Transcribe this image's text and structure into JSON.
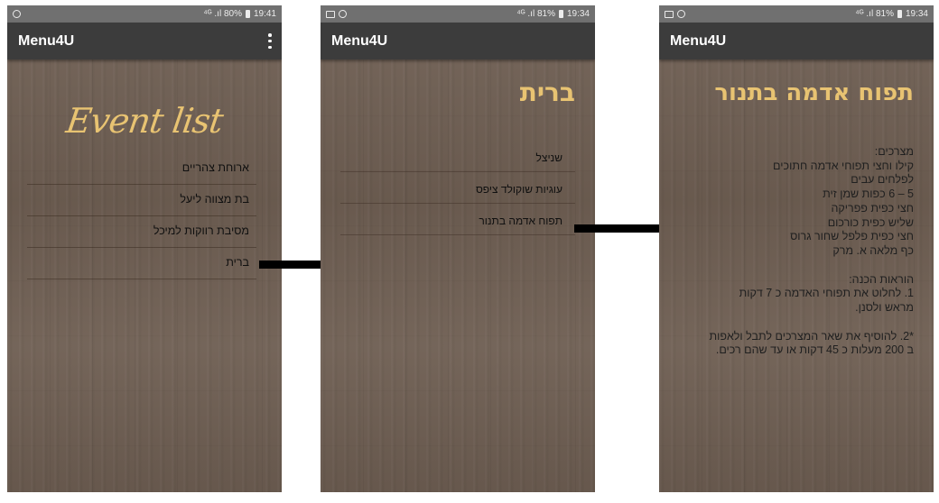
{
  "screens": [
    {
      "status": {
        "left_icons": [
          "whatsapp-icon"
        ],
        "right_text": "ὐ7 ⁴ᴳ .ıl 80%",
        "battery": "battery-icon",
        "time": "19:41"
      },
      "app_title": "Menu4U",
      "heading": "Event list",
      "items": [
        "ארוחת צהריים",
        "בת מצווה ליעל",
        "מסיבת רווקות למיכל",
        "ברית"
      ]
    },
    {
      "status": {
        "left_icons": [
          "image-icon",
          "whatsapp-icon"
        ],
        "right_text": "⁴ᴳ .ıl 81%",
        "battery": "battery-icon",
        "time": "19:34"
      },
      "app_title": "Menu4U",
      "heading": "ברית",
      "items": [
        "שניצל",
        "עוגיות שוקולד ציפס",
        "תפוח אדמה בתנור"
      ]
    },
    {
      "status": {
        "left_icons": [
          "image-icon",
          "whatsapp-icon"
        ],
        "right_text": "⁴ᴳ .ıl 81%",
        "battery": "battery-icon",
        "time": "19:34"
      },
      "app_title": "Menu4U",
      "heading": "תפוח אדמה בתנור",
      "recipe_lines": [
        "מצרכים:",
        "קילו וחצי תפוחי אדמה חתוכים",
        "לפלחים עבים",
        "5 – 6 כפות שמן זית",
        "חצי כפית פפריקה",
        "שליש כפית כורכום",
        "חצי כפית פלפל שחור גרוס",
        "כף מלאה א. מרק",
        "",
        "הוראות הכנה:",
        "1. לחלוט את תפוחי האדמה כ 7 דקות",
        "מראש ולסנן.",
        "",
        "*2. להוסיף את שאר המצרכים לתבל ולאפות",
        "ב 200 מעלות כ 45 דקות או עד שהם רכים."
      ]
    }
  ],
  "colors": {
    "heading_gold": "#e8c372",
    "appbar": "#3c3c3c",
    "statusbar": "#707070",
    "wood": "#6f5f53",
    "arrow": "#000000"
  },
  "arrows": [
    "arrow-right",
    "arrow-right"
  ]
}
